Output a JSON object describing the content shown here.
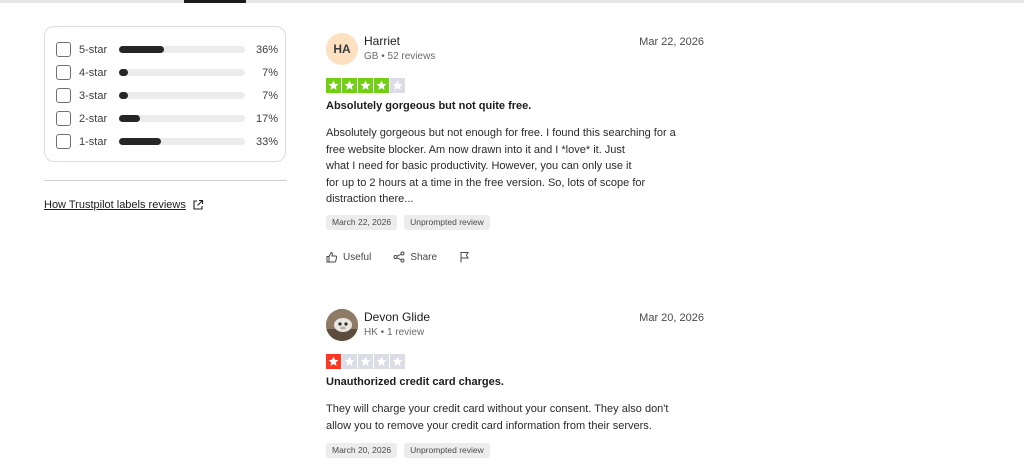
{
  "rating_filter": {
    "rows": [
      {
        "label": "5-star",
        "percent": "36%",
        "fraction": 0.36
      },
      {
        "label": "4-star",
        "percent": "7%",
        "fraction": 0.07
      },
      {
        "label": "3-star",
        "percent": "7%",
        "fraction": 0.07
      },
      {
        "label": "2-star",
        "percent": "17%",
        "fraction": 0.17
      },
      {
        "label": "1-star",
        "percent": "33%",
        "fraction": 0.33
      }
    ]
  },
  "labels_link": "How Trustpilot labels reviews",
  "colors": {
    "star_4": "#73cf11",
    "star_1": "#ff3722",
    "star_empty": "#dcdce6",
    "avatar_initials_bg": "#fde0c0"
  },
  "reviews": [
    {
      "avatar_initials": "HA",
      "name": "Harriet",
      "meta": "GB • 52 reviews",
      "date": "Mar 22, 2026",
      "rating": 4,
      "title": "Absolutely gorgeous but not quite free.",
      "body_lines": [
        "Absolutely gorgeous but not enough for free. I found this searching for a",
        "free website blocker. Am now drawn into it and I *love* it. Just",
        "what I need for basic productivity. However, you can only use it",
        "for up to 2 hours at a time in the free version. So, lots of scope for",
        "distraction there..."
      ],
      "tags": [
        "March 22, 2026",
        "Unprompted review"
      ],
      "actions": {
        "useful": "Useful",
        "share": "Share"
      }
    },
    {
      "avatar_initials": "",
      "name": "Devon Glide",
      "meta": "HK • 1 review",
      "date": "Mar 20, 2026",
      "rating": 1,
      "title": "Unauthorized credit card charges.",
      "body_lines": [
        "They will charge your credit card without your consent. They also don't",
        "allow you to remove your credit card information from their servers."
      ],
      "tags": [
        "March 20, 2026",
        "Unprompted review"
      ]
    }
  ]
}
